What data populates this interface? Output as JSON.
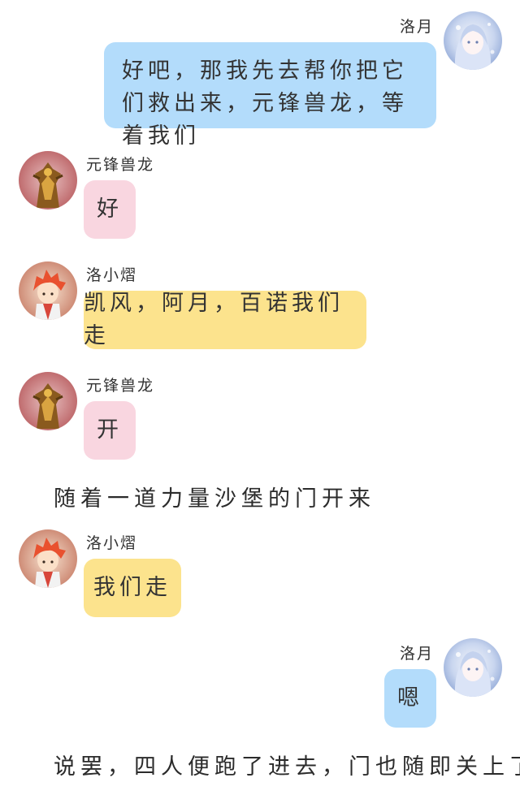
{
  "messages": [
    {
      "speaker": "洛月",
      "side": "right",
      "color": "blue",
      "avatar": "moon-avatar",
      "text": "好吧，那我先去帮你把它们救出来，元锋兽龙，等着我们"
    },
    {
      "speaker": "元锋兽龙",
      "side": "left",
      "color": "pink",
      "avatar": "beast-dragon-avatar",
      "text": "好"
    },
    {
      "speaker": "洛小熠",
      "side": "left",
      "color": "yellow",
      "avatar": "red-hair-boy-avatar",
      "text": "凯风，阿月，百诺我们走"
    },
    {
      "speaker": "元锋兽龙",
      "side": "left",
      "color": "pink",
      "avatar": "beast-dragon-avatar",
      "text": "开"
    },
    {
      "narration": "随着一道力量沙堡的门开来"
    },
    {
      "speaker": "洛小熠",
      "side": "left",
      "color": "yellow",
      "avatar": "red-hair-boy-avatar",
      "text": "我们走"
    },
    {
      "speaker": "洛月",
      "side": "right",
      "color": "blue",
      "avatar": "moon-avatar",
      "text": "嗯"
    },
    {
      "narration": "说罢，四人便跑了进去，门也随即关上了"
    }
  ],
  "colors": {
    "blue": "#b3dcfb",
    "pink": "#f9d6e0",
    "yellow": "#fce38d"
  }
}
